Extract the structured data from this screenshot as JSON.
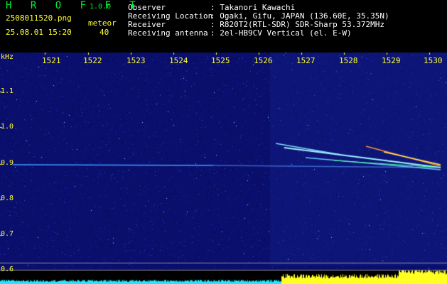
{
  "app": {
    "name": "H R O F F T",
    "version": "1.0.0"
  },
  "file": {
    "name": "2508011520.png",
    "datetime": "25.08.01 15:20"
  },
  "meteor": {
    "label": "meteor",
    "count": "40"
  },
  "info": [
    {
      "key": "Observer",
      "value": ": Takanori Kawachi"
    },
    {
      "key": "Receiving Location",
      "value": ": Ogaki, Gifu, JAPAN (136.60E, 35.35N)"
    },
    {
      "key": "Receiver",
      "value": ": R820T2(RTL-SDR) SDR-Sharp 53.372MHz"
    },
    {
      "key": "Receiving antenna",
      "value": ": 2el-HB9CV Vertical (el. E-W)"
    }
  ],
  "axis": {
    "y_unit": "kHz",
    "x_ticks": [
      "1521",
      "1522",
      "1523",
      "1524",
      "1525",
      "1526",
      "1527",
      "1528",
      "1529",
      "1530"
    ],
    "y_ticks": [
      "1.1",
      "1.0",
      "0.9",
      "0.8",
      "0.7",
      "0.6"
    ]
  },
  "colors": {
    "background": "#000000",
    "text": "#ffff33",
    "title": "#00ee33",
    "waterfall": "#0a0f6e",
    "noise_bar": "#22e6ff",
    "signal_bar": "#ffff22"
  }
}
